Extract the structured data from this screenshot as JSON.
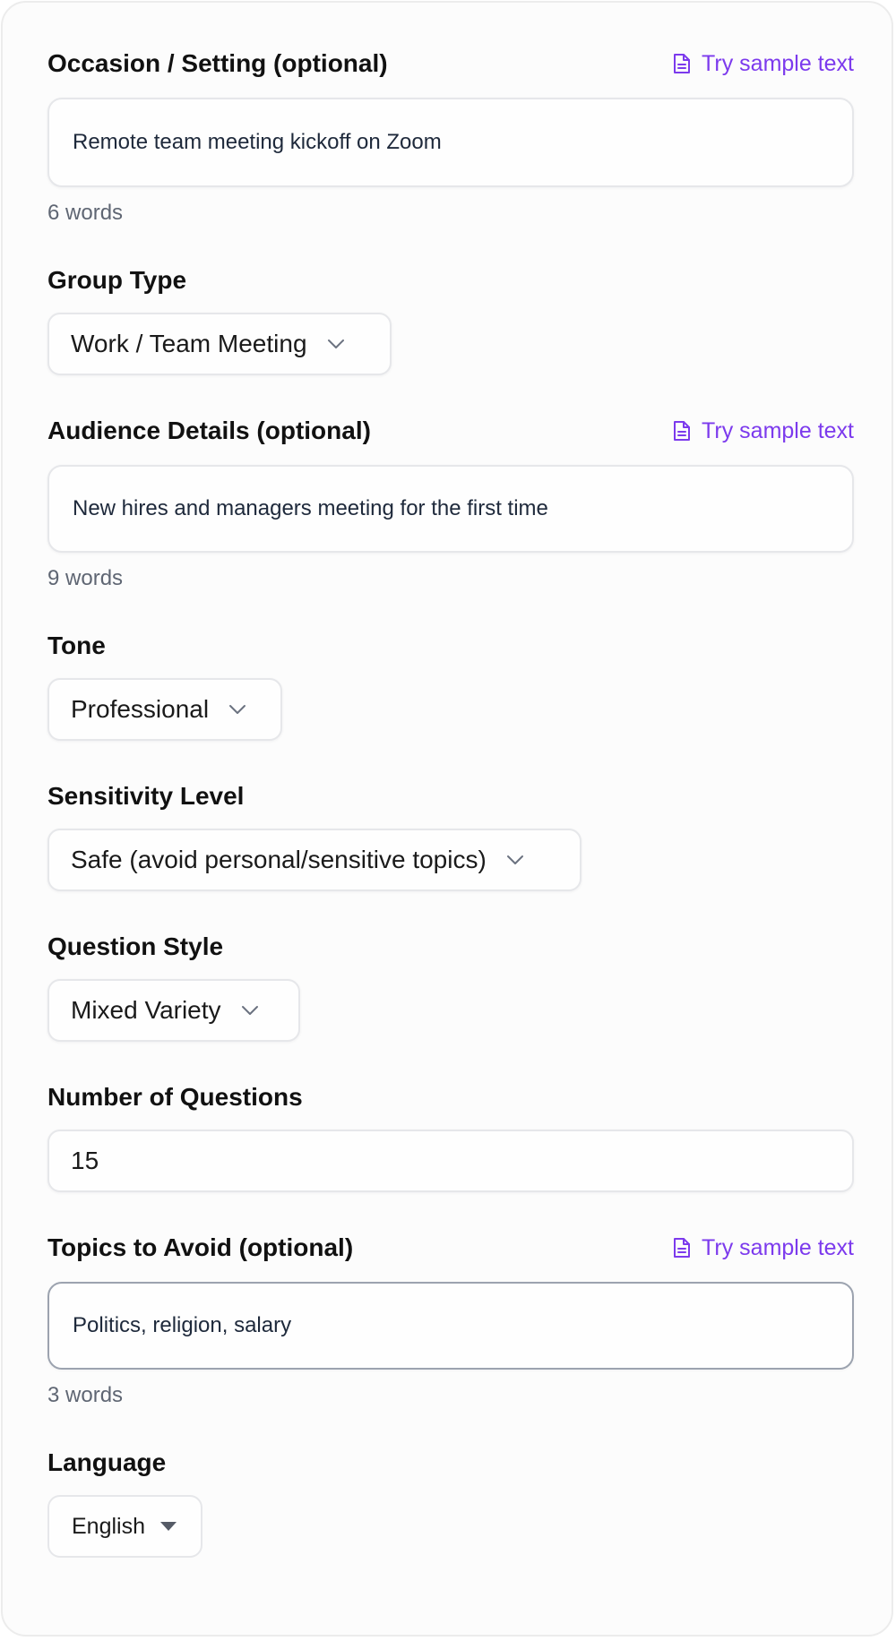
{
  "sample_link_label": "Try sample text",
  "occasion": {
    "label": "Occasion / Setting (optional)",
    "value": "Remote team meeting kickoff on Zoom",
    "word_count": "6 words"
  },
  "group_type": {
    "label": "Group Type",
    "selected": "Work / Team Meeting"
  },
  "audience": {
    "label": "Audience Details (optional)",
    "value": "New hires and managers meeting for the first time",
    "word_count": "9 words"
  },
  "tone": {
    "label": "Tone",
    "selected": "Professional"
  },
  "sensitivity": {
    "label": "Sensitivity Level",
    "selected": "Safe (avoid personal/sensitive topics)"
  },
  "question_style": {
    "label": "Question Style",
    "selected": "Mixed Variety"
  },
  "num_questions": {
    "label": "Number of Questions",
    "value": "15"
  },
  "avoid": {
    "label": "Topics to Avoid (optional)",
    "value": "Politics, religion, salary",
    "word_count": "3 words"
  },
  "language": {
    "label": "Language",
    "selected": "English"
  },
  "colors": {
    "accent": "#7c3aed",
    "border": "#e6e7ea",
    "focus_border": "#9ca3af",
    "muted_text": "#5f6673"
  },
  "icons": {
    "sample_link": "document-icon",
    "select": "chevron-down-icon",
    "language": "caret-down-icon"
  }
}
